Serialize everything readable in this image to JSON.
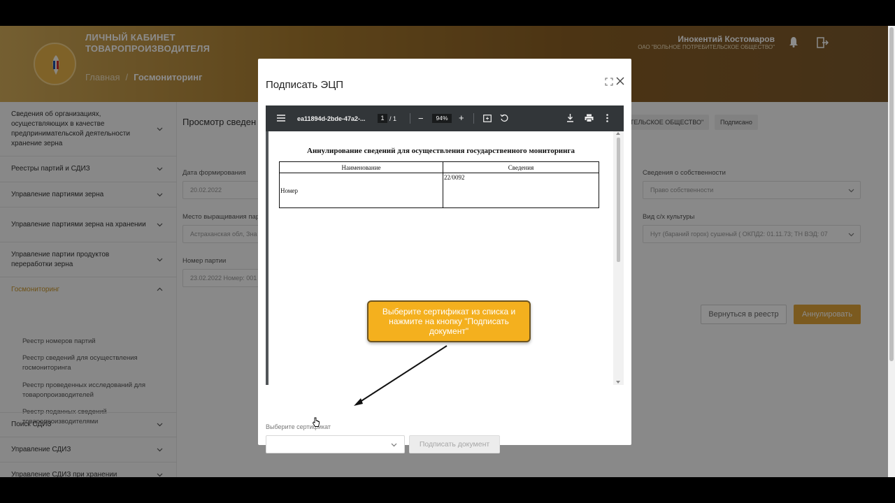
{
  "header": {
    "app_title": "ЛИЧНЫЙ КАБИНЕТ ТОВАРОПРОИЗВОДИТЕЛЯ",
    "breadcrumb_home": "Главная",
    "breadcrumb_sep": "/",
    "breadcrumb_current": "Госмониторинг",
    "user_name": "Инокентий Костомаров",
    "user_org": "ОАО \"ВОЛЬНОЕ ПОТРЕБИТЕЛЬСКОЕ ОБЩЕСТВО\""
  },
  "sidebar": {
    "items": [
      {
        "label": "Сведения об организациях, осуществляющих в качестве предпринимательской деятельности хранение зерна"
      },
      {
        "label": "Реестры партий и СДИЗ"
      },
      {
        "label": "Управление партиями зерна"
      },
      {
        "label": "Управление партиями зерна на хранении"
      },
      {
        "label": "Управление партии продуктов переработки зерна"
      },
      {
        "label": "Госмониторинг"
      },
      {
        "label": "Поиск СДИЗ"
      },
      {
        "label": "Управление СДИЗ"
      },
      {
        "label": "Управление СДИЗ при хранении"
      }
    ],
    "sub_items": [
      {
        "label": "Реестр номеров партий"
      },
      {
        "label": "Реестр сведений для осуществления госмониторинга"
      },
      {
        "label": "Реестр проведенных исследований для товаропроизводителей"
      },
      {
        "label": "Реестр поданных сведений товаропроизводителями"
      }
    ]
  },
  "main": {
    "page_head": "Просмотр сведен",
    "chip_org": "ТЕЛЬСКОЕ ОБЩЕСТВО\"",
    "chip_status": "Подписано",
    "date_label": "Дата формирования",
    "date_value": "20.02.2022",
    "place_label": "Место выращивания пар",
    "place_value": "Астраханская обл, Зна",
    "batch_label": "Номер партии",
    "batch_value": "23.02.2022 Номер:  001",
    "ownership_label": "Сведения о собственности",
    "ownership_value": "Право собственности",
    "crop_label": "Вид с/х культуры",
    "crop_value": "Нут (бараний горох) сушеный ( ОКПД2: 01.11.73; ТН ВЭД: 07",
    "back_button": "Вернуться в реестр",
    "cancel_button": "Аннулировать"
  },
  "modal": {
    "title": "Подписать ЭЦП",
    "viewer": {
      "doc_name": "ea11894d-2bde-47a2-...",
      "page_current": "1",
      "page_total": "/  1",
      "zoom": "94%",
      "minus": "−",
      "plus": "+"
    },
    "pdf": {
      "title": "Аннулирование сведений для осуществления государственного мониторинга",
      "col_name": "Наименование",
      "col_value": "Сведения",
      "row_label": "Номер",
      "row_value": "22/0092"
    },
    "cert_label": "Выберите сертификат",
    "cert_value": "",
    "sign_button": "Подписать документ"
  },
  "callout": {
    "text": "Выберите сертификат из списка и нажмите на кнопку \"Подписать документ\""
  },
  "colors": {
    "accent": "#e0a53a",
    "callout": "#f4b01e",
    "active_menu": "#c8952a"
  }
}
